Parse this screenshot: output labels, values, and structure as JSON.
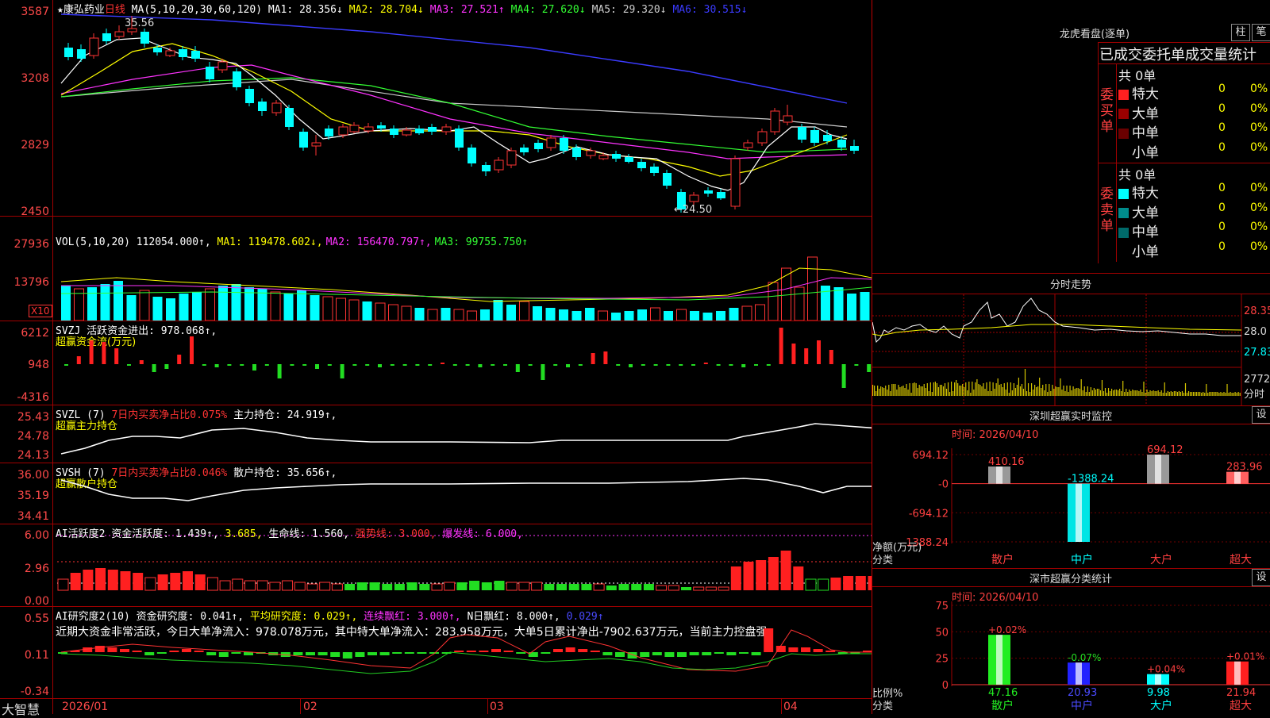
{
  "stock": {
    "name_label": "★康弘药业",
    "period": "日线",
    "ma_header": "MA(5,10,20,30,60,120)",
    "ma": [
      {
        "label": "MA1: 28.356↓",
        "color": "#ffffff"
      },
      {
        "label": "MA2: 28.704↓",
        "color": "#ffff00"
      },
      {
        "label": "MA3: 27.521↑",
        "color": "#ff33ff"
      },
      {
        "label": "MA4: 27.620↓",
        "color": "#33ff33"
      },
      {
        "label": "MA5: 29.320↓",
        "color": "#cccccc"
      },
      {
        "label": "MA6: 30.515↓",
        "color": "#3b3bff"
      }
    ],
    "high_note": "35.56",
    "low_note": "←24.50",
    "y_ticks": [
      "3587",
      "3208",
      "2829",
      "2450"
    ]
  },
  "vol": {
    "header": "VOL(5,10,20)",
    "value": "112054.000↑,",
    "ma": [
      {
        "label": "MA1: 119478.602↓,",
        "color": "#ffff00"
      },
      {
        "label": "MA2: 156470.797↑,",
        "color": "#ff33ff"
      },
      {
        "label": "MA3: 99755.750↑",
        "color": "#33ff33"
      }
    ],
    "y_ticks": [
      "27936",
      "13796"
    ],
    "unit": "X10"
  },
  "svzj": {
    "header": "SVZJ  活跃资金进出: 978.068↑,",
    "sub": "超赢资金流(万元)",
    "y_ticks": [
      "6212",
      "948",
      "-4316"
    ]
  },
  "svzl": {
    "header_a": "SVZL (7)",
    "header_b": "7日内买卖净占比0.075%",
    "header_c": "主力持仓: 24.919↑,",
    "sub": "超赢主力持仓",
    "y_ticks": [
      "25.43",
      "24.78",
      "24.13"
    ]
  },
  "svsh": {
    "header_a": "SVSH (7)",
    "header_b": "7日内买卖净占比0.046%",
    "header_c": "散户持仓: 35.656↑,",
    "sub": "超赢散户持仓",
    "y_ticks": [
      "36.00",
      "35.19",
      "34.41"
    ]
  },
  "ai1": {
    "header_a": "AI活跃度2 资金活跃度: 1.439↑,",
    "header_b": "3.685,",
    "header_c": "生命线: 1.560,",
    "header_d": "强势线: 3.000,",
    "header_e": "爆发线: 6.000,",
    "y_ticks": [
      "6.00",
      "2.96",
      "0.00"
    ]
  },
  "ai2": {
    "header_a": "AI研究度2(10) 资金研究度: 0.041↑,",
    "header_b": "平均研究度: 0.029↑,",
    "header_c": "连续飘红: 3.000↑,",
    "header_d": "N日飘红: 8.000↑,",
    "header_e": "0.029↑",
    "comment": "近期大资金非常活跃，今日大单净流入：978.078万元，其中特大单净流入：283.958万元，大单5日累计净出-7902.637万元，当前主力控盘强",
    "y_ticks": [
      "0.55",
      "0.11",
      "-0.34"
    ]
  },
  "xaxis": {
    "brand": "大智慧",
    "labels": [
      "2026/01",
      "02",
      "03",
      "04"
    ]
  },
  "right": {
    "lhb_title": "龙虎看盘(逐单)",
    "btn_zhu": "柱",
    "btn_bi": "笔",
    "stat_title": "已成交委托单成交量统计",
    "buy_total": "共 0单",
    "buy_side": "委买单",
    "sell_total": "共 0单",
    "sell_side": "委卖单",
    "buy_rows": [
      {
        "name": "特大",
        "count": "0",
        "pct": "0%",
        "color": "#ff2020"
      },
      {
        "name": "大单",
        "count": "0",
        "pct": "0%",
        "color": "#9a0000"
      },
      {
        "name": "中单",
        "count": "0",
        "pct": "0%",
        "color": "#6a0000"
      },
      {
        "name": "小单",
        "count": "0",
        "pct": "0%",
        "color": "#000000"
      }
    ],
    "sell_rows": [
      {
        "name": "特大",
        "count": "0",
        "pct": "0%",
        "color": "#00ffff"
      },
      {
        "name": "大单",
        "count": "0",
        "pct": "0%",
        "color": "#008c8c"
      },
      {
        "name": "中单",
        "count": "0",
        "pct": "0%",
        "color": "#006a6a"
      },
      {
        "name": "小单",
        "count": "0",
        "pct": "0%",
        "color": "#000000"
      }
    ],
    "intraday_title": "分时走势",
    "intraday_prices": [
      "28.35",
      "28.0",
      "27.83"
    ],
    "intraday_vol": "2772",
    "intraday_vol_unit": "分时",
    "monitor_title": "深圳超赢实时监控",
    "monitor_btn": "设",
    "monitor_time": "时间: 2026/04/10",
    "monitor_y": [
      "694.12",
      "-0",
      "-694.12",
      "-1388.24"
    ],
    "monitor_axis_label": "净额(万元)",
    "monitor_cat_label": "分类",
    "class_title": "深市超赢分类统计",
    "class_btn": "设",
    "class_time": "时间: 2026/04/10",
    "class_y": [
      "75",
      "50",
      "25",
      "0"
    ],
    "class_axis_label": "比例%",
    "class_cat_label": "分类"
  },
  "chart_data": [
    {
      "type": "bar",
      "title": "深圳超赢实时监控",
      "ylabel": "净额(万元)",
      "categories": [
        "散户",
        "中户",
        "大户",
        "超大"
      ],
      "values": [
        410.16,
        -1388.24,
        694.12,
        283.96
      ],
      "value_labels": [
        "410.16",
        "-1388.24",
        "694.12",
        "283.96"
      ],
      "ylim": [
        -1388.24,
        694.12
      ]
    },
    {
      "type": "bar",
      "title": "深市超赢分类统计",
      "ylabel": "比例%",
      "categories": [
        "散户",
        "中户",
        "大户",
        "超大"
      ],
      "values": [
        47.16,
        20.93,
        9.98,
        21.94
      ],
      "value_labels": [
        "47.16",
        "20.93",
        "9.98",
        "21.94"
      ],
      "change_labels": [
        "+0.02%",
        "-0.07%",
        "+0.04%",
        "+0.01%"
      ],
      "ylim": [
        0,
        75
      ]
    }
  ]
}
